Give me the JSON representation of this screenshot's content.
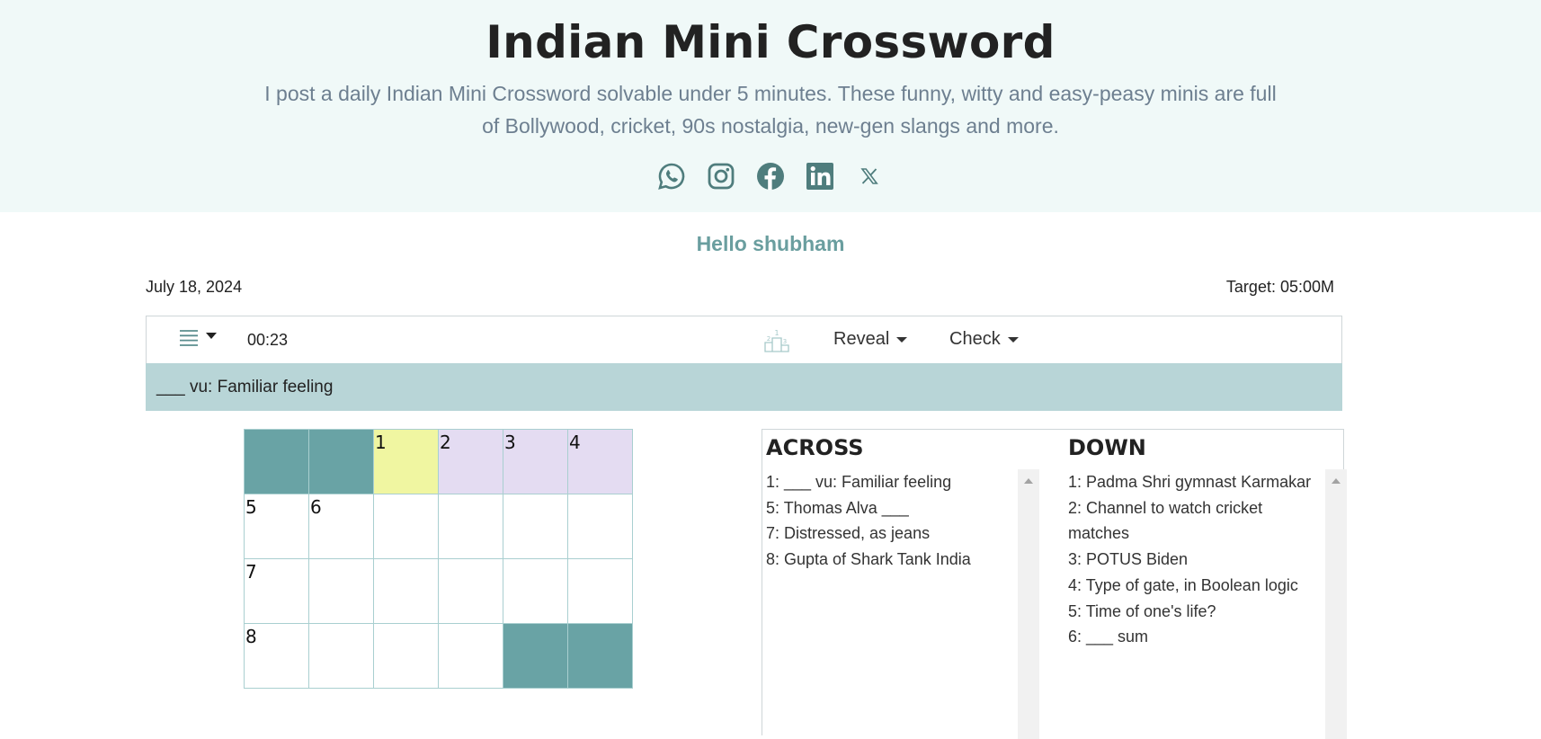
{
  "header": {
    "title": "Indian Mini Crossword",
    "subtitle": "I post a daily Indian Mini Crossword solvable under 5 minutes. These funny, witty and easy-peasy minis are full of Bollywood, cricket, 90s nostalgia, new-gen slangs and more.",
    "socials": [
      "whatsapp-icon",
      "instagram-icon",
      "facebook-icon",
      "linkedin-icon",
      "x-icon"
    ]
  },
  "greeting": "Hello shubham",
  "meta": {
    "date": "July 18, 2024",
    "target": "Target: 05:00M"
  },
  "toolbar": {
    "timer": "00:23",
    "reveal_label": "Reveal",
    "check_label": "Check"
  },
  "current_clue": "___ vu: Familiar feeling",
  "grid": {
    "rows": 4,
    "cols": 6,
    "blocks": [
      [
        0,
        0
      ],
      [
        0,
        1
      ],
      [
        3,
        4
      ],
      [
        3,
        5
      ]
    ],
    "numbers": {
      "0,2": "1",
      "0,3": "2",
      "0,4": "3",
      "0,5": "4",
      "1,0": "5",
      "1,1": "6",
      "2,0": "7",
      "3,0": "8"
    },
    "active": [
      0,
      2
    ],
    "highlighted": [
      [
        0,
        3
      ],
      [
        0,
        4
      ],
      [
        0,
        5
      ]
    ]
  },
  "clues": {
    "across_title": "ACROSS",
    "across": [
      "1: ___ vu: Familiar feeling",
      "5: Thomas Alva ___",
      "7: Distressed, as jeans",
      "8: Gupta of Shark Tank India"
    ],
    "down_title": "DOWN",
    "down": [
      "1: Padma Shri gymnast Karmakar",
      "2: Channel to watch cricket matches",
      "3: POTUS Biden",
      "4: Type of gate, in Boolean logic",
      "5: Time of one's life?",
      "6: ___ sum"
    ]
  },
  "colors": {
    "block": "#69a3a5",
    "active": "#f0f6a1",
    "highlight": "#e4dcf2",
    "clue_bar": "#b8d5d7",
    "icon": "#4f7d7d"
  }
}
